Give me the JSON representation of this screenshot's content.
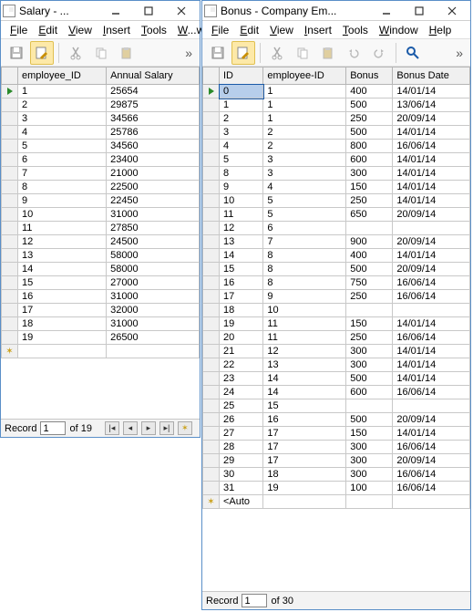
{
  "win_salary": {
    "title": "Salary - ...",
    "menus": [
      "File",
      "Edit",
      "View",
      "Insert",
      "Tools",
      "W...w"
    ],
    "status": {
      "label": "Record",
      "current": "1",
      "of": "of 19"
    },
    "columns": [
      "employee_ID",
      "Annual Salary"
    ],
    "rows": [
      [
        "1",
        "25654"
      ],
      [
        "2",
        "29875"
      ],
      [
        "3",
        "34566"
      ],
      [
        "4",
        "25786"
      ],
      [
        "5",
        "34560"
      ],
      [
        "6",
        "23400"
      ],
      [
        "7",
        "21000"
      ],
      [
        "8",
        "22500"
      ],
      [
        "9",
        "22450"
      ],
      [
        "10",
        "31000"
      ],
      [
        "11",
        "27850"
      ],
      [
        "12",
        "24500"
      ],
      [
        "13",
        "58000"
      ],
      [
        "14",
        "58000"
      ],
      [
        "15",
        "27000"
      ],
      [
        "16",
        "31000"
      ],
      [
        "17",
        "32000"
      ],
      [
        "18",
        "31000"
      ],
      [
        "19",
        "26500"
      ]
    ]
  },
  "win_bonus": {
    "title": "Bonus - Company Em...",
    "menus": [
      "File",
      "Edit",
      "View",
      "Insert",
      "Tools",
      "Window",
      "Help"
    ],
    "status": {
      "label": "Record",
      "current": "1",
      "of": "of 30"
    },
    "columns": [
      "ID",
      "employee-ID",
      "Bonus",
      "Bonus Date"
    ],
    "new_row_label": "<Auto",
    "rows": [
      [
        "0",
        "1",
        "400",
        "14/01/14"
      ],
      [
        "1",
        "1",
        "500",
        "13/06/14"
      ],
      [
        "2",
        "1",
        "250",
        "20/09/14"
      ],
      [
        "3",
        "2",
        "500",
        "14/01/14"
      ],
      [
        "4",
        "2",
        "800",
        "16/06/14"
      ],
      [
        "5",
        "3",
        "600",
        "14/01/14"
      ],
      [
        "8",
        "3",
        "300",
        "14/01/14"
      ],
      [
        "9",
        "4",
        "150",
        "14/01/14"
      ],
      [
        "10",
        "5",
        "250",
        "14/01/14"
      ],
      [
        "11",
        "5",
        "650",
        "20/09/14"
      ],
      [
        "12",
        "6",
        "",
        ""
      ],
      [
        "13",
        "7",
        "900",
        "20/09/14"
      ],
      [
        "14",
        "8",
        "400",
        "14/01/14"
      ],
      [
        "15",
        "8",
        "500",
        "20/09/14"
      ],
      [
        "16",
        "8",
        "750",
        "16/06/14"
      ],
      [
        "17",
        "9",
        "250",
        "16/06/14"
      ],
      [
        "18",
        "10",
        "",
        ""
      ],
      [
        "19",
        "11",
        "150",
        "14/01/14"
      ],
      [
        "20",
        "11",
        "250",
        "16/06/14"
      ],
      [
        "21",
        "12",
        "300",
        "14/01/14"
      ],
      [
        "22",
        "13",
        "300",
        "14/01/14"
      ],
      [
        "23",
        "14",
        "500",
        "14/01/14"
      ],
      [
        "24",
        "14",
        "600",
        "16/06/14"
      ],
      [
        "25",
        "15",
        "",
        ""
      ],
      [
        "26",
        "16",
        "500",
        "20/09/14"
      ],
      [
        "27",
        "17",
        "150",
        "14/01/14"
      ],
      [
        "28",
        "17",
        "300",
        "16/06/14"
      ],
      [
        "29",
        "17",
        "300",
        "20/09/14"
      ],
      [
        "30",
        "18",
        "300",
        "16/06/14"
      ],
      [
        "31",
        "19",
        "100",
        "16/06/14"
      ]
    ]
  }
}
